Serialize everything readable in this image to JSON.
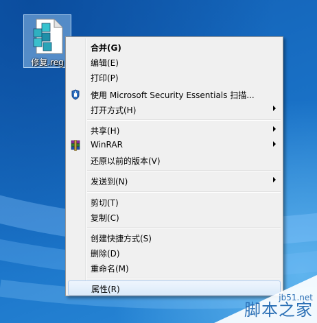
{
  "desktop_icon": {
    "label": "修复.reg",
    "icon": "registry-file-icon"
  },
  "context_menu": {
    "items": [
      {
        "label": "合并(G)",
        "bold": true
      },
      {
        "label": "编辑(E)"
      },
      {
        "label": "打印(P)"
      },
      {
        "label": "使用 Microsoft Security Essentials 扫描...",
        "icon": "mse-shield-icon"
      },
      {
        "label": "打开方式(H)",
        "submenu": true
      },
      {
        "label": "共享(H)",
        "submenu": true
      },
      {
        "label": "WinRAR",
        "icon": "winrar-icon",
        "submenu": true
      },
      {
        "label": "还原以前的版本(V)"
      },
      {
        "label": "发送到(N)",
        "submenu": true
      },
      {
        "label": "剪切(T)"
      },
      {
        "label": "复制(C)"
      },
      {
        "label": "创建快捷方式(S)"
      },
      {
        "label": "删除(D)"
      },
      {
        "label": "重命名(M)"
      },
      {
        "label": "属性(R)",
        "highlighted": true
      }
    ]
  },
  "watermark": {
    "site": "jb51.net",
    "brand": "脚本之家"
  }
}
